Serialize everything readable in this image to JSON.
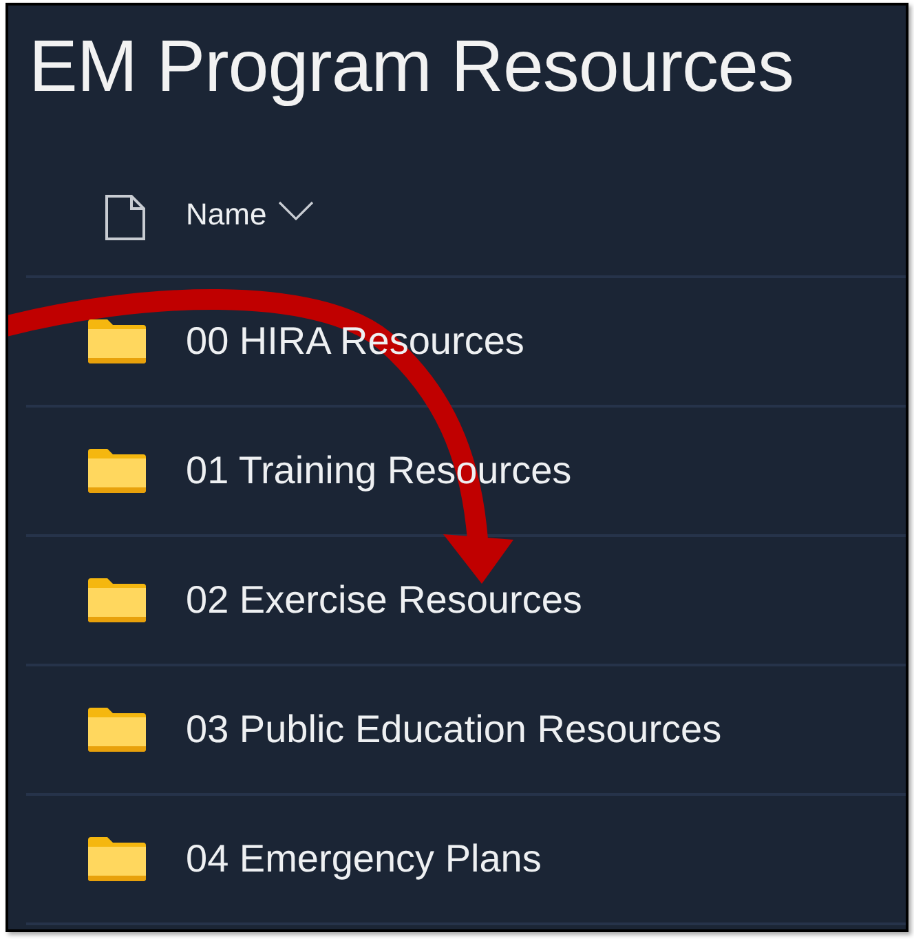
{
  "title": "EM Program Resources",
  "table": {
    "columns": [
      {
        "label": "Name",
        "sorted": true
      }
    ],
    "rows": [
      {
        "name": "00 HIRA Resources"
      },
      {
        "name": "01 Training Resources"
      },
      {
        "name": "02 Exercise Resources"
      },
      {
        "name": "03 Public Education Resources"
      },
      {
        "name": "04 Emergency Plans"
      }
    ]
  }
}
